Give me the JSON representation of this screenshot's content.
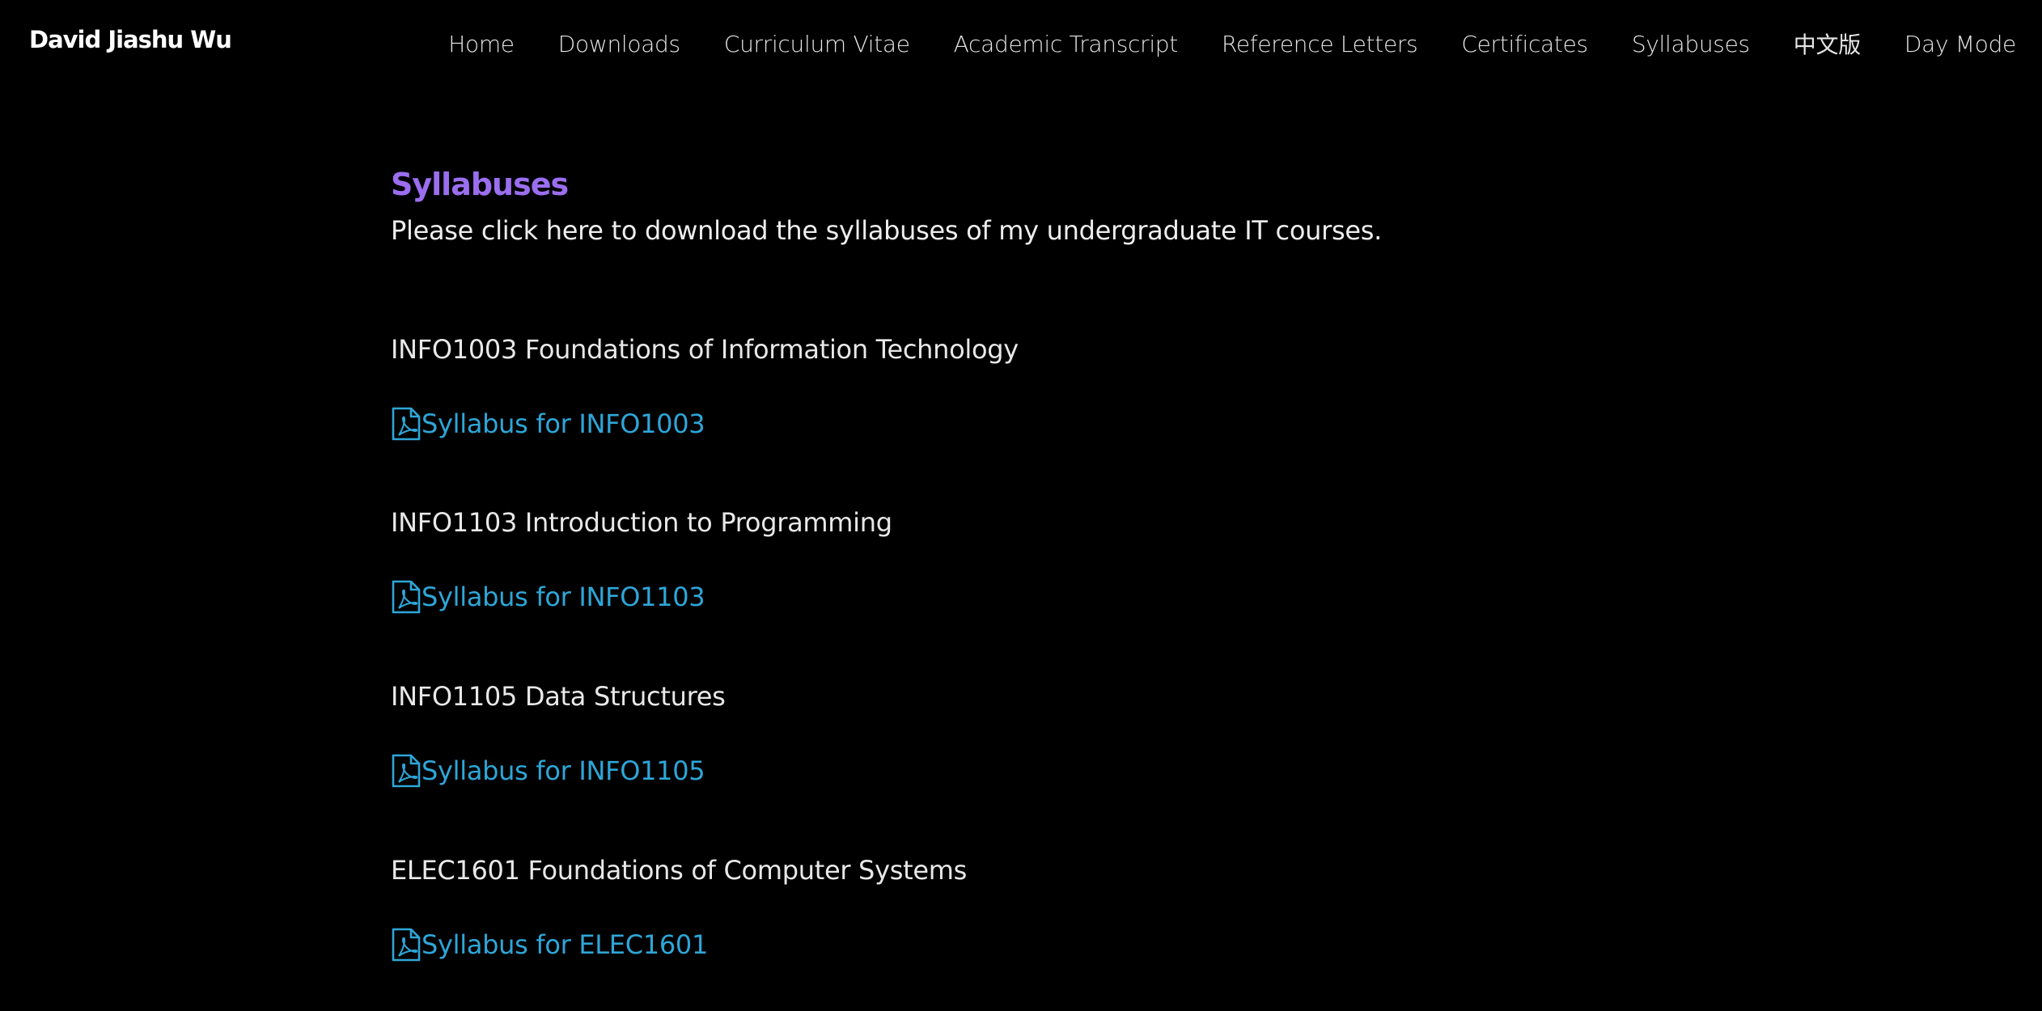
{
  "header": {
    "brand": "David Jiashu Wu",
    "nav": [
      {
        "label": "Home"
      },
      {
        "label": "Downloads"
      },
      {
        "label": "Curriculum Vitae"
      },
      {
        "label": "Academic Transcript"
      },
      {
        "label": "Reference Letters"
      },
      {
        "label": "Certificates"
      },
      {
        "label": "Syllabuses"
      },
      {
        "label": "中文版"
      },
      {
        "label": "Day Mode"
      }
    ]
  },
  "main": {
    "title": "Syllabuses",
    "intro": "Please click here to download the syllabuses of my undergraduate IT courses.",
    "courses": [
      {
        "title": "INFO1003 Foundations of Information Technology",
        "link": "Syllabus for INFO1003",
        "icon": "pdf-file-icon"
      },
      {
        "title": "INFO1103 Introduction to Programming",
        "link": "Syllabus for INFO1103",
        "icon": "pdf-file-icon"
      },
      {
        "title": "INFO1105 Data Structures",
        "link": "Syllabus for INFO1105",
        "icon": "pdf-file-icon"
      },
      {
        "title": "ELEC1601 Foundations of Computer Systems",
        "link": "Syllabus for ELEC1601",
        "icon": "pdf-file-icon"
      }
    ]
  },
  "colors": {
    "background": "#000000",
    "title_accent": "#9b6ef0",
    "link": "#2ea6d8",
    "text": "#e8e8e8"
  }
}
